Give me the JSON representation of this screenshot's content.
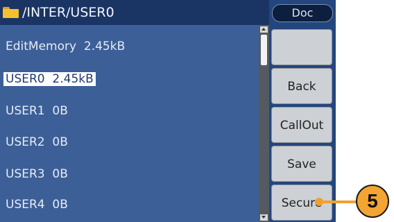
{
  "header": {
    "path": "/INTER/USER0",
    "folder_icon": "folder-icon"
  },
  "files": [
    {
      "name": "EditMemory",
      "size": "2.45kB",
      "selected": false
    },
    {
      "name": "USER0",
      "size": "2.45kB",
      "selected": true
    },
    {
      "name": "USER1",
      "size": "0B",
      "selected": false
    },
    {
      "name": "USER2",
      "size": "0B",
      "selected": false
    },
    {
      "name": "USER3",
      "size": "0B",
      "selected": false
    },
    {
      "name": "USER4",
      "size": "0B",
      "selected": false
    }
  ],
  "sidepanel": {
    "title": "Doc",
    "softkeys": [
      "",
      "Back",
      "CallOut",
      "Save",
      "Secure"
    ]
  },
  "callout": {
    "number": "5"
  },
  "colors": {
    "screen_bg": "#2b4d83",
    "header_bg": "#1a3564",
    "callout": "#f0a030"
  }
}
